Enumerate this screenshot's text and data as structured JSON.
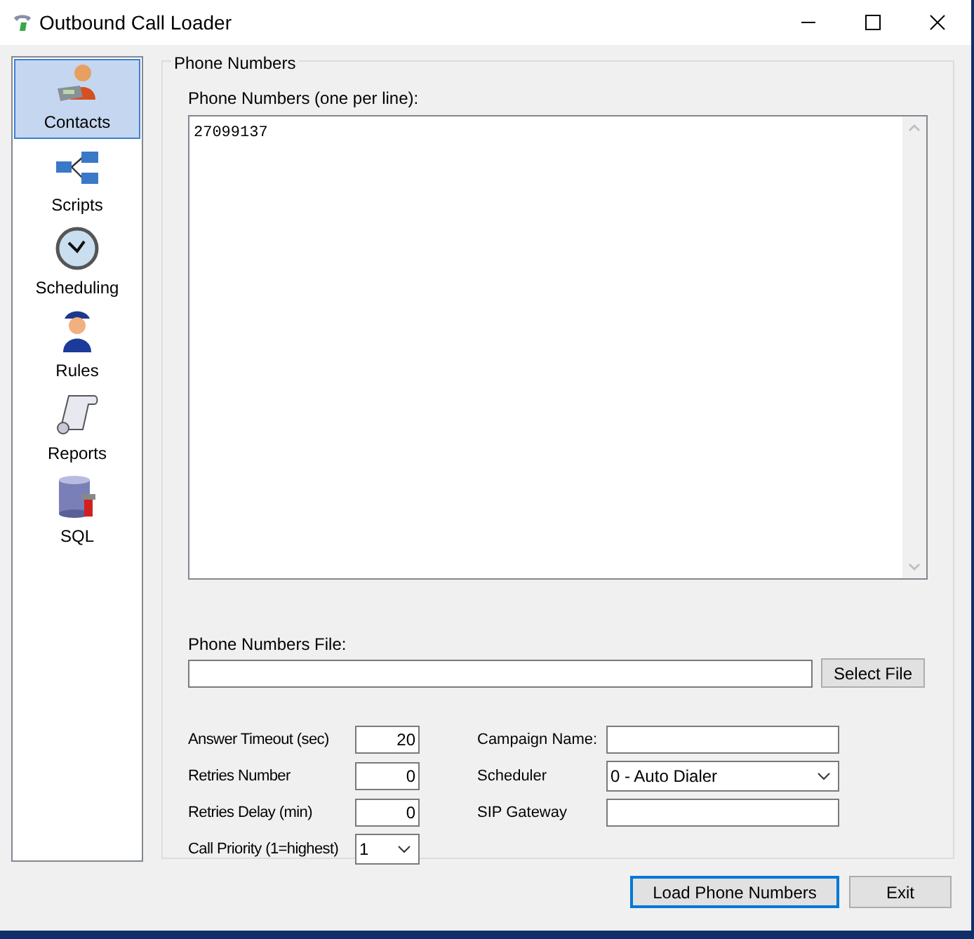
{
  "window": {
    "title": "Outbound Call Loader"
  },
  "sidebar": {
    "items": [
      {
        "label": "Contacts",
        "selected": true
      },
      {
        "label": "Scripts",
        "selected": false
      },
      {
        "label": "Scheduling",
        "selected": false
      },
      {
        "label": "Rules",
        "selected": false
      },
      {
        "label": "Reports",
        "selected": false
      },
      {
        "label": "SQL",
        "selected": false
      }
    ]
  },
  "group": {
    "legend": "Phone Numbers",
    "phone_numbers": {
      "label": "Phone Numbers (one per line):",
      "value": "27099137"
    },
    "file": {
      "label": "Phone Numbers File:"
    },
    "select_file_button": "Select File",
    "left_fields": [
      {
        "label": "Answer Timeout (sec)",
        "value": "20",
        "kind": "text"
      },
      {
        "label": "Retries Number",
        "value": "0",
        "kind": "text"
      },
      {
        "label": "Retries Delay (min)",
        "value": "0",
        "kind": "text"
      },
      {
        "label": "Call Priority (1=highest)",
        "value": "1",
        "kind": "dropdown"
      }
    ],
    "right_fields": [
      {
        "label": "Campaign Name:",
        "kind": "text"
      },
      {
        "label": "Scheduler",
        "value": "0 - Auto Dialer",
        "kind": "dropdown"
      },
      {
        "label": "SIP Gateway",
        "kind": "text"
      }
    ]
  },
  "buttons": [
    {
      "label": "Load Phone Numbers",
      "default": true
    },
    {
      "label": "Exit",
      "default": false
    }
  ]
}
